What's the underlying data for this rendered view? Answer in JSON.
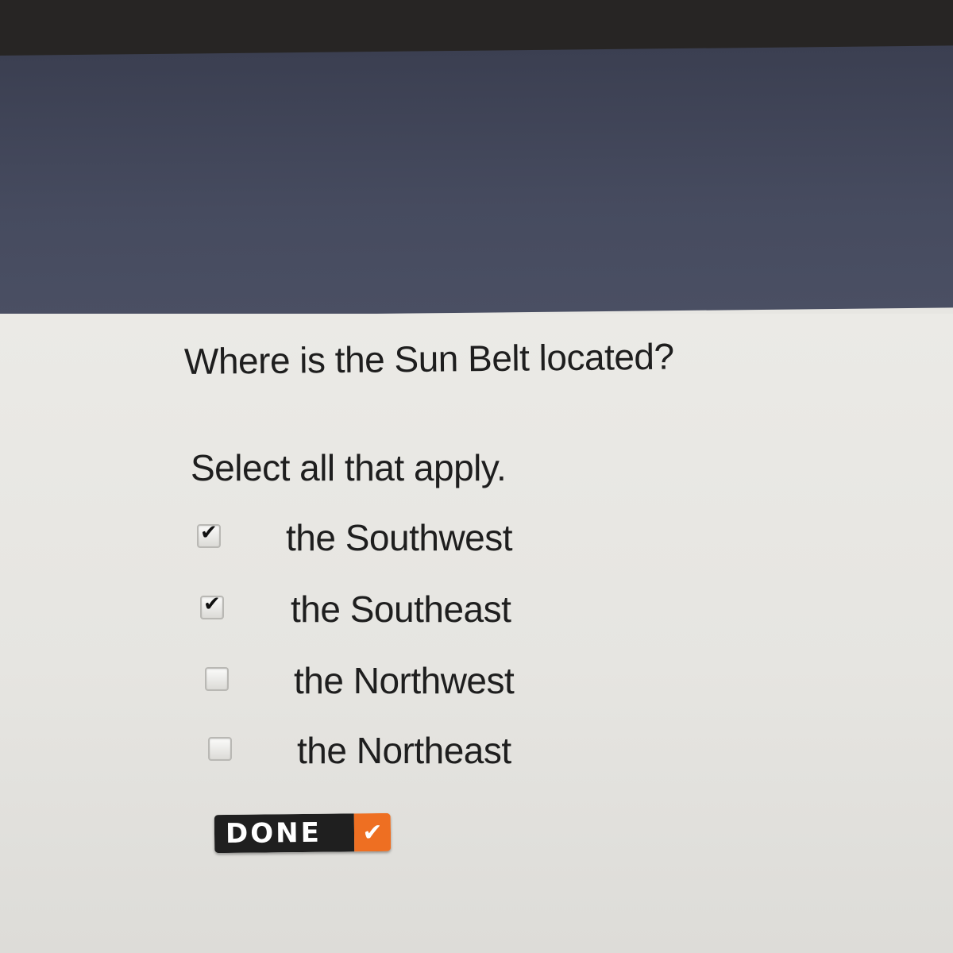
{
  "question": {
    "prompt": "Where is the Sun Belt located?",
    "instruction": "Select all that apply."
  },
  "options": [
    {
      "label": "the Southwest",
      "checked": true
    },
    {
      "label": "the Southeast",
      "checked": true
    },
    {
      "label": "the Northwest",
      "checked": false
    },
    {
      "label": "the Northeast",
      "checked": false
    }
  ],
  "done_button": {
    "label": "DONE",
    "icon": "checkmark-icon",
    "accent_color": "#ee6f22"
  },
  "colors": {
    "header_band": "#464b5f",
    "content_background": "#e7e6e2",
    "text": "#1e1e1e"
  }
}
